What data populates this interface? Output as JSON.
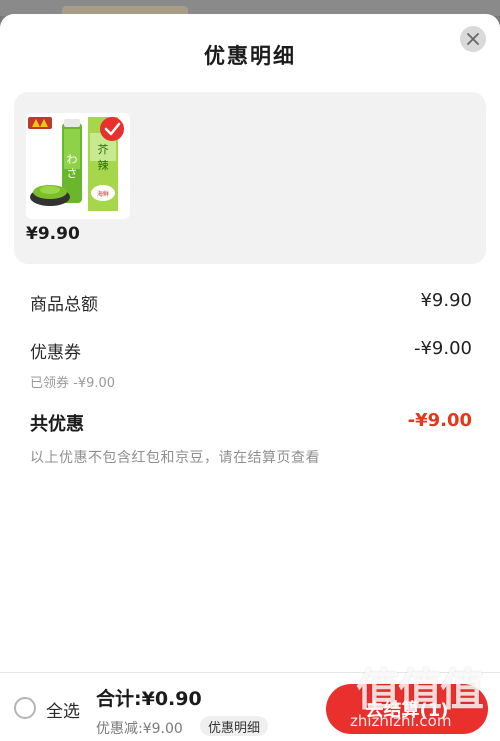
{
  "sheet": {
    "title": "优惠明细",
    "close_icon": "close-icon"
  },
  "product": {
    "price": "¥9.90",
    "image_alt": "wasabi tube product image",
    "selected": true
  },
  "summary": {
    "total_label": "商品总额",
    "total_value": "¥9.90",
    "coupon_label": "优惠券",
    "coupon_value": "-¥9.00",
    "coupon_sub": "已领券 -¥9.00",
    "all_discount_label": "共优惠",
    "all_discount_value": "-¥9.00",
    "note": "以上优惠不包含红包和京豆，请在结算页查看"
  },
  "bottom_bar": {
    "select_all_label": "全选",
    "total_text": "合计:¥0.90",
    "discount_text": "优惠减:¥9.00",
    "detail_chip": "优惠明细",
    "checkout_label": "去结算(1)"
  },
  "watermark": {
    "main": "值值值",
    "url": "zhizhizhi.com"
  },
  "colors": {
    "accent": "#e9302d",
    "discount_red": "#e3381d",
    "card_bg": "#f2f2f2"
  }
}
